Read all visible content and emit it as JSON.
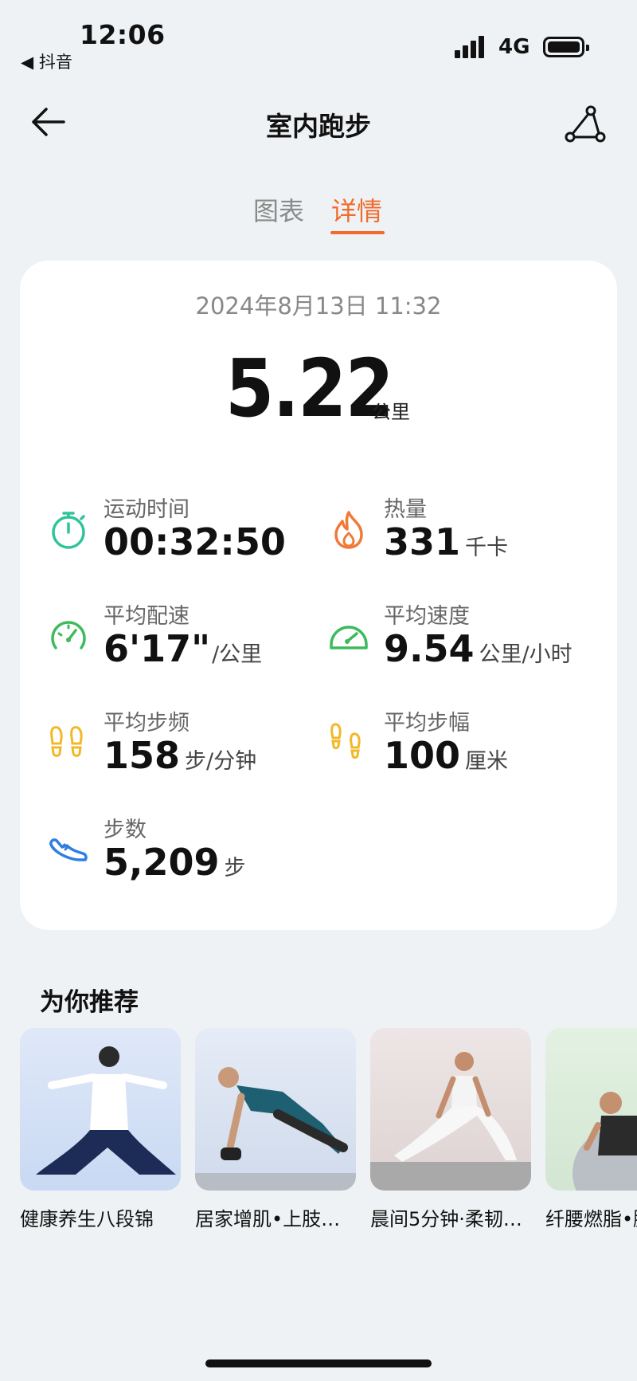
{
  "status_bar": {
    "time": "12:06",
    "back_app": "◀ 抖音",
    "network": "4G"
  },
  "nav": {
    "title": "室内跑步",
    "back_icon": "arrow-left-icon",
    "share_icon": "route-share-icon"
  },
  "tabs": [
    {
      "label": "图表",
      "active": false
    },
    {
      "label": "详情",
      "active": true
    }
  ],
  "accent_color": "#f06b2c",
  "summary": {
    "date": "2024年8月13日 11:32",
    "distance": "5.22",
    "distance_unit": "公里"
  },
  "metrics": [
    {
      "label": "运动时间",
      "value": "00:32:50",
      "unit": "",
      "icon": "stopwatch-icon",
      "color": "#2ec49a"
    },
    {
      "label": "热量",
      "value": "331",
      "unit": "千卡",
      "icon": "flame-icon",
      "color": "#f07a3a"
    },
    {
      "label": "平均配速",
      "value": "6'17\"",
      "unit": "/公里",
      "icon": "speedometer-icon",
      "color": "#3dbb5c"
    },
    {
      "label": "平均速度",
      "value": "9.54",
      "unit": "公里/小时",
      "icon": "gauge-icon",
      "color": "#3dbb5c"
    },
    {
      "label": "平均步频",
      "value": "158",
      "unit": "步/分钟",
      "icon": "footprints-icon",
      "color": "#f2b825"
    },
    {
      "label": "平均步幅",
      "value": "100",
      "unit": "厘米",
      "icon": "footsteps-icon",
      "color": "#f2b825"
    },
    {
      "label": "步数",
      "value": "5,209",
      "unit": "步",
      "icon": "shoe-icon",
      "color": "#2f7fe0"
    }
  ],
  "recommendations": {
    "title": "为你推荐",
    "items": [
      {
        "label": "健康养生八段锦",
        "icon": "tai-chi-thumbnail"
      },
      {
        "label": "居家增肌•上肢…",
        "icon": "dumbbell-workout-thumbnail"
      },
      {
        "label": "晨间5分钟·柔韧…",
        "icon": "yoga-stretch-thumbnail"
      },
      {
        "label": "纤腰燃脂•腰…",
        "icon": "ball-exercise-thumbnail"
      }
    ]
  }
}
